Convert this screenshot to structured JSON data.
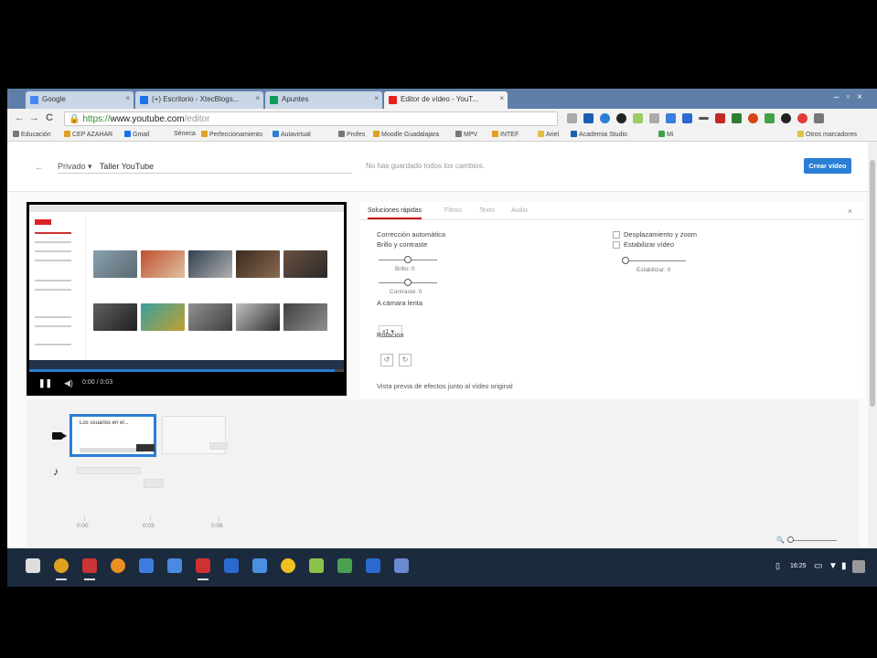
{
  "browser": {
    "tabs": [
      {
        "label": "Google",
        "color": "#4285f4"
      },
      {
        "label": "(+) Escritorio - XtecBlogs...",
        "color": "#1a73e8"
      },
      {
        "label": "Apuntes",
        "color": "#0f9d58"
      },
      {
        "label": "Editor de vídeo - YouT...",
        "color": "#e62117"
      }
    ],
    "url": {
      "scheme": "https://",
      "host": "www.youtube.com",
      "path": "/editor"
    },
    "bookmarks": [
      "Educación",
      "CEP AZAHAR",
      "Gmail",
      "Séneca",
      "Perfeccionamiento",
      "Aulavirtual",
      "Profes",
      "Moodle Guadalajara",
      "MPV",
      "INTEF",
      "Ariel",
      "Academia Studio",
      "Mi",
      "Otros marcadores"
    ],
    "window_controls": [
      "–",
      "▫",
      "×"
    ],
    "nav": {
      "back": "←",
      "forward": "→",
      "reload": "C"
    }
  },
  "editor": {
    "back_icon": "←",
    "privacy": "Privado ▾",
    "title": "Taller YouTube",
    "unsaved_note": "No has guardado todos los cambios.",
    "create_button": "Crear vídeo",
    "tabs": [
      "Soluciones rápidas",
      "Filtros",
      "Texto",
      "Audio"
    ],
    "close": "×",
    "quick_fixes": {
      "auto_correction": "Corrección automática",
      "brightness_contrast": "Brillo y contraste",
      "brightness": "Brillo: 0",
      "contrast": "Contraste: 0",
      "slow_motion": "A cámara lenta",
      "slow_motion_value": "x1 ▾",
      "rotation": "Rotación",
      "pan_zoom": "Desplazamiento y zoom",
      "stabilize": "Estabilizar vídeo",
      "stabilization": "Estabilizar: 0",
      "compare": "Vista previa de efectos junto al vídeo original"
    },
    "player": {
      "pause": "❚❚",
      "volume": "◀)",
      "time": "0:00 / 0:03",
      "progress": 0.97
    },
    "timeline": {
      "clip_caption": "Los usuarios en el...",
      "ticks": [
        "0:00",
        "0:03",
        "0:06"
      ],
      "zoom_icon": "🔍"
    }
  },
  "shelf": {
    "apps": [
      {
        "name": "launcher",
        "color": "#dddddd"
      },
      {
        "name": "chrome",
        "color": "#e0a020"
      },
      {
        "name": "gmail",
        "color": "#cc3333"
      },
      {
        "name": "headphones",
        "color": "#e89020"
      },
      {
        "name": "docs",
        "color": "#3b7de0"
      },
      {
        "name": "files",
        "color": "#4a8ae0"
      },
      {
        "name": "screencast",
        "color": "#d03030"
      },
      {
        "name": "shield",
        "color": "#2a6ad0"
      },
      {
        "name": "photos",
        "color": "#4a90e0"
      },
      {
        "name": "drive",
        "color": "#f0c020"
      },
      {
        "name": "android",
        "color": "#8bc34a"
      },
      {
        "name": "pin",
        "color": "#4aa050"
      },
      {
        "name": "camera",
        "color": "#2a6ad0"
      },
      {
        "name": "calculator",
        "color": "#6a8ad0"
      }
    ],
    "clock": "16:25"
  }
}
